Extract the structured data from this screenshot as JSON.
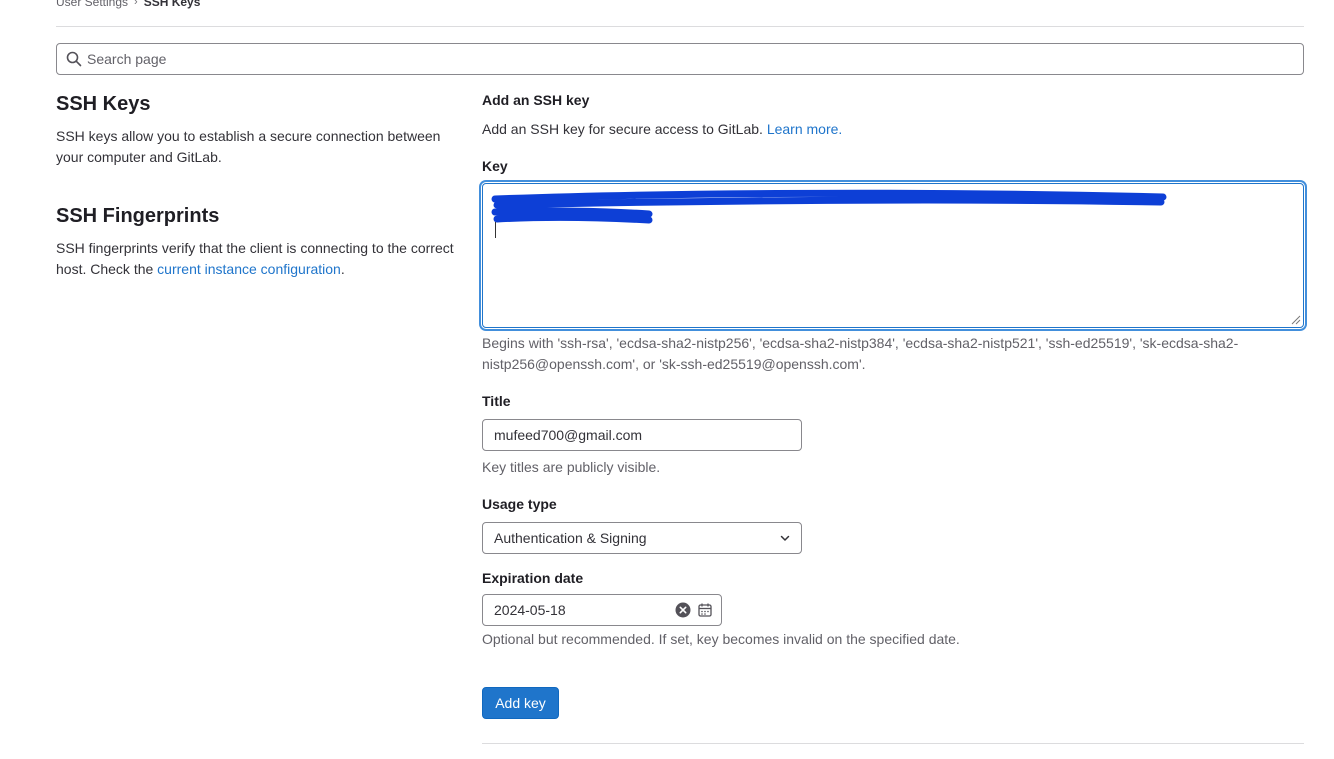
{
  "breadcrumb": {
    "parent": "User Settings",
    "separator": "›",
    "current": "SSH Keys"
  },
  "search": {
    "placeholder": "Search page",
    "icon": "search-icon"
  },
  "left": {
    "ssh_keys": {
      "title": "SSH Keys",
      "description": "SSH keys allow you to establish a secure connection between your computer and GitLab."
    },
    "fingerprints": {
      "title": "SSH Fingerprints",
      "description_prefix": "SSH fingerprints verify that the client is connecting to the correct host. Check the ",
      "link_text": "current instance configuration",
      "description_suffix": "."
    }
  },
  "form": {
    "heading": "Add an SSH key",
    "intro": "Add an SSH key for secure access to GitLab.",
    "learn_more": "Learn more.",
    "key_label": "Key",
    "key_help": "Begins with 'ssh-rsa', 'ecdsa-sha2-nistp256', 'ecdsa-sha2-nistp384', 'ecdsa-sha2-nistp521', 'ssh-ed25519', 'sk-ecdsa-sha2-nistp256@openssh.com', or 'sk-ssh-ed25519@openssh.com'.",
    "title_label": "Title",
    "title_value": "mufeed700@gmail.com",
    "title_help": "Key titles are publicly visible.",
    "usage_label": "Usage type",
    "usage_value": "Authentication & Signing",
    "expiration_label": "Expiration date",
    "expiration_value": "2024-05-18",
    "expiration_help": "Optional but recommended. If set, key becomes invalid on the specified date.",
    "submit_label": "Add key"
  },
  "colors": {
    "accent": "#1f75cb",
    "redaction": "#0d3fd6"
  }
}
